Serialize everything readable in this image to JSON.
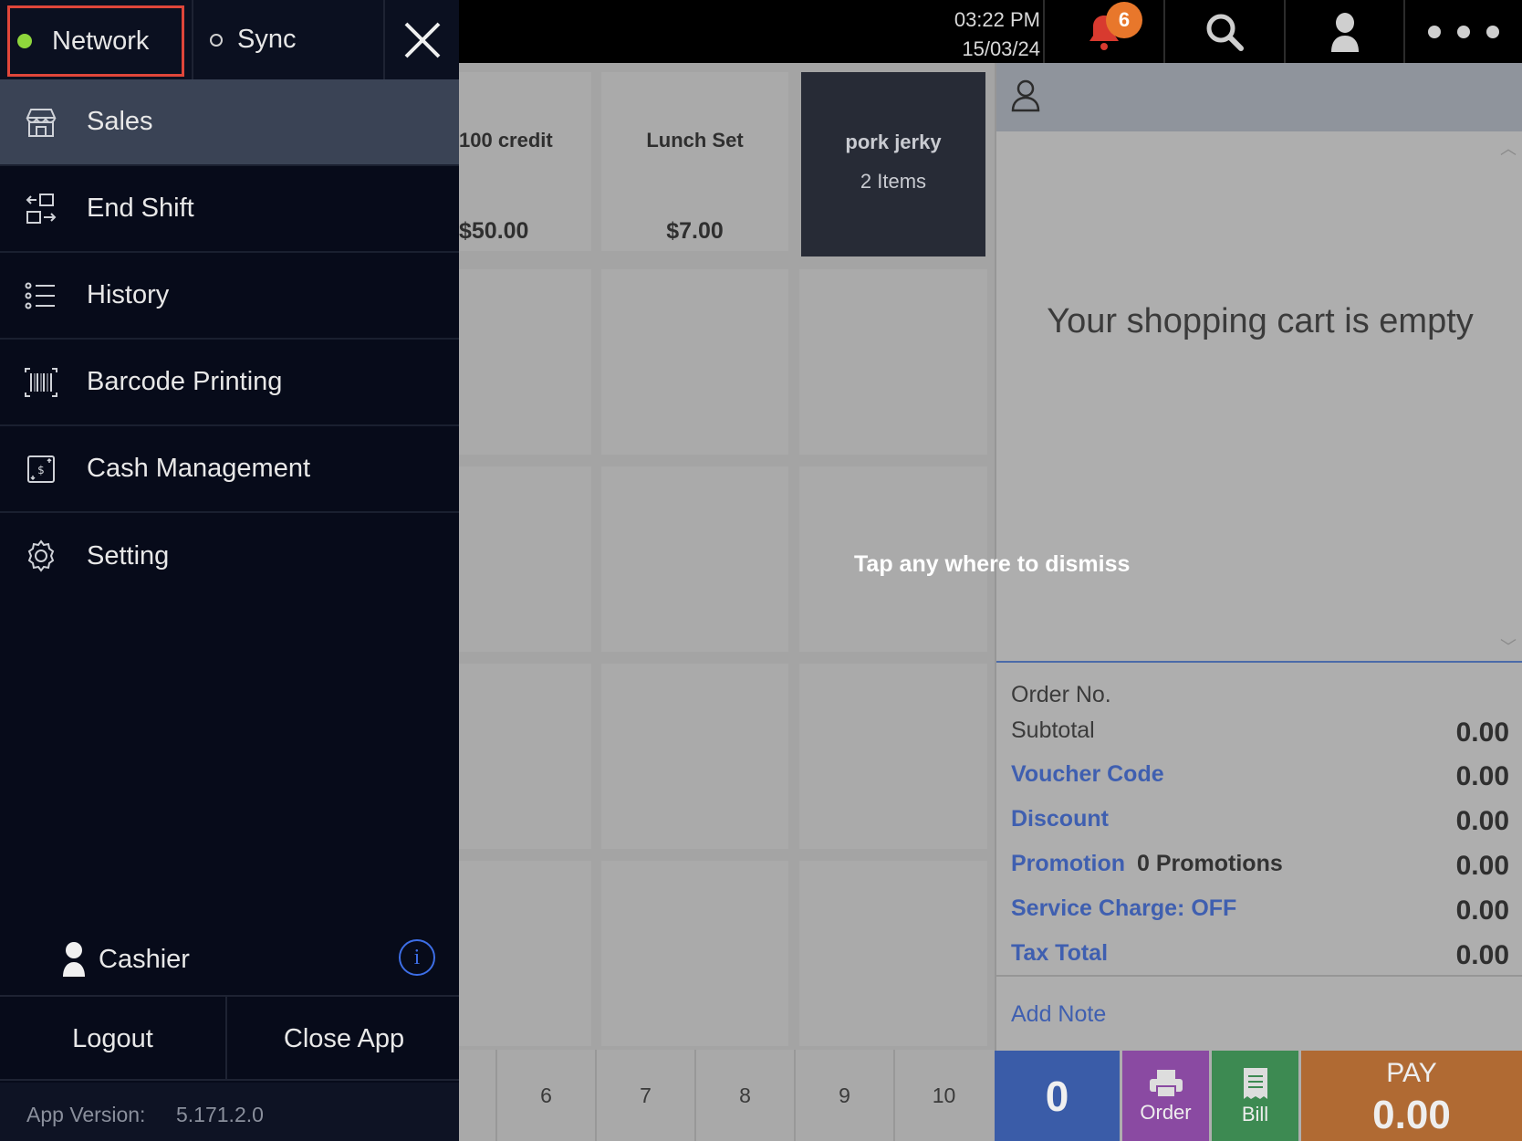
{
  "topbar": {
    "time": "03:22 PM",
    "date": "15/03/24",
    "notification_count": "6"
  },
  "products": [
    {
      "name": "100 credit",
      "price": "$50.00"
    },
    {
      "name": "Lunch Set",
      "price": "$7.00"
    },
    {
      "name": "pork jerky",
      "count": "2 Items"
    }
  ],
  "pages": [
    "6",
    "7",
    "8",
    "9",
    "10"
  ],
  "overlay": {
    "dismiss_text": "Tap any where to dismiss"
  },
  "cart": {
    "empty_text": "Your shopping cart is empty",
    "order_no_label": "Order No.",
    "rows": [
      {
        "label": "Subtotal",
        "value": "0.00"
      },
      {
        "label": "Voucher Code",
        "value": "0.00"
      },
      {
        "label": "Discount",
        "value": "0.00"
      },
      {
        "label": "Promotion",
        "extra": "0 Promotions",
        "value": "0.00"
      },
      {
        "label": "Service Charge: OFF",
        "value": "0.00"
      },
      {
        "label": "Tax Total",
        "value": "0.00"
      }
    ],
    "add_note": "Add Note",
    "qty": "0",
    "order_label": "Order",
    "bill_label": "Bill",
    "pay_label": "PAY",
    "pay_amount": "0.00"
  },
  "drawer": {
    "network_label": "Network",
    "sync_label": "Sync",
    "menu": [
      {
        "label": "Sales",
        "icon": "store-icon"
      },
      {
        "label": "End Shift",
        "icon": "end-shift-icon"
      },
      {
        "label": "History",
        "icon": "list-icon"
      },
      {
        "label": "Barcode Printing",
        "icon": "barcode-icon"
      },
      {
        "label": "Cash Management",
        "icon": "cash-icon"
      },
      {
        "label": "Setting",
        "icon": "gear-icon"
      }
    ],
    "user_label": "Cashier",
    "logout_label": "Logout",
    "close_app_label": "Close App",
    "app_version_label": "App Version:",
    "app_version": "5.171.2.0"
  },
  "colors": {
    "drawer_bg": "#070b1a",
    "active_item": "#3a4355",
    "network_highlight": "#e0463a",
    "network_dot": "#8fd63c",
    "accent_blue": "#3f5fb0",
    "order_btn": "#8a4aa2",
    "bill_btn": "#3d8a52",
    "pay_btn": "#b06a33",
    "badge": "#e8772b"
  }
}
